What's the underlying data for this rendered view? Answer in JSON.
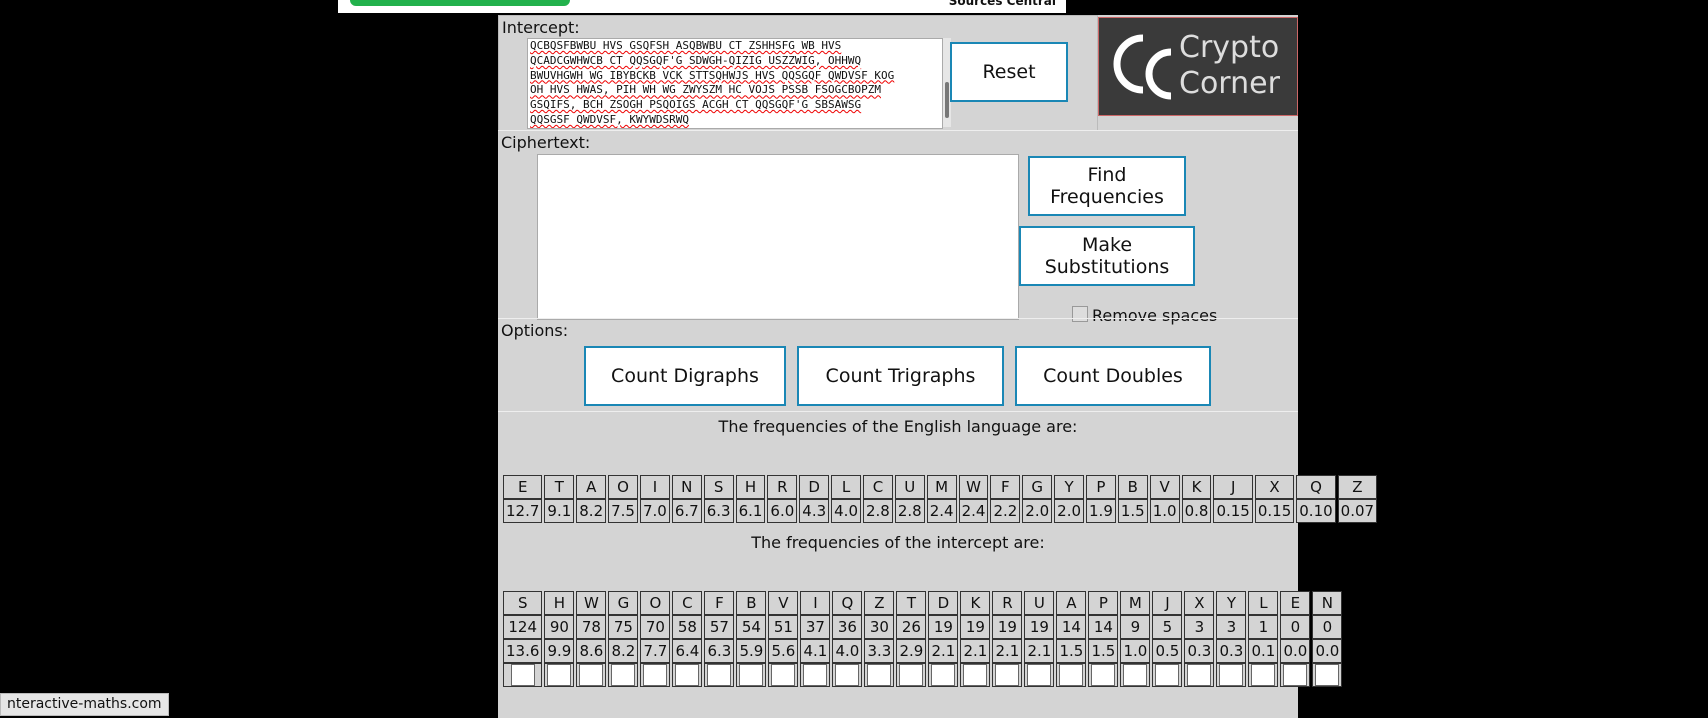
{
  "top": {
    "nav_text": "Sources Central"
  },
  "intercept": {
    "legend": "Intercept:",
    "lines": [
      "QCBQSFBWBU HVS GSQFSH ASQBWBU CT ZSHHSFG WB HVS",
      "QCADCGWHWCB CT QQSGQF'G SDWGH-QIZIG USZZWIG, OHHWQ",
      "BWUVHGWH WG IBYBCKB VCK STTSQHWJS HVS QQSGQF QWDVSF KOG",
      "OH HVS HWAS, PIH WH WG ZWYSZM HC VOJS PSSB FSOGCBOPZM",
      "GSQIFS, BCH ZSOGH PSQOIGS ACGH CT QQSGQF'G SBSAWSG",
      "QQSGSF QWDVSF, KWYWDSRWQ"
    ]
  },
  "buttons": {
    "reset": "Reset",
    "find_frequencies": "Find Frequencies",
    "make_substitutions": "Make Substitutions",
    "count_digraphs": "Count Digraphs",
    "count_trigraphs": "Count Trigraphs",
    "count_doubles": "Count Doubles"
  },
  "logo": {
    "line1": "Crypto",
    "line2": "Corner"
  },
  "ciphertext": {
    "legend": "Ciphertext:",
    "value": ""
  },
  "remove_spaces": {
    "label": "Remove spaces",
    "checked": false
  },
  "options": {
    "legend": "Options:"
  },
  "english": {
    "title": "The frequencies of the English language are:",
    "letters": [
      "E",
      "T",
      "A",
      "O",
      "I",
      "N",
      "S",
      "H",
      "R",
      "D",
      "L",
      "C",
      "U",
      "M",
      "W",
      "F",
      "G",
      "Y",
      "P",
      "B",
      "V",
      "K",
      "J",
      "X",
      "Q",
      "Z"
    ],
    "values": [
      "12.7",
      "9.1",
      "8.2",
      "7.5",
      "7.0",
      "6.7",
      "6.3",
      "6.1",
      "6.0",
      "4.3",
      "4.0",
      "2.8",
      "2.8",
      "2.4",
      "2.4",
      "2.2",
      "2.0",
      "2.0",
      "1.9",
      "1.5",
      "1.0",
      "0.8",
      "0.15",
      "0.15",
      "0.10",
      "0.07"
    ]
  },
  "intercept_freq": {
    "title": "The frequencies of the intercept are:",
    "letters": [
      "S",
      "H",
      "W",
      "G",
      "O",
      "C",
      "F",
      "B",
      "V",
      "I",
      "Q",
      "Z",
      "T",
      "D",
      "K",
      "R",
      "U",
      "A",
      "P",
      "M",
      "J",
      "X",
      "Y",
      "L",
      "E",
      "N"
    ],
    "counts": [
      "124",
      "90",
      "78",
      "75",
      "70",
      "58",
      "57",
      "54",
      "51",
      "37",
      "36",
      "30",
      "26",
      "19",
      "19",
      "19",
      "19",
      "14",
      "14",
      "9",
      "5",
      "3",
      "3",
      "1",
      "0",
      "0"
    ],
    "percents": [
      "13.6",
      "9.9",
      "8.6",
      "8.2",
      "7.7",
      "6.4",
      "6.3",
      "5.9",
      "5.6",
      "4.1",
      "4.0",
      "3.3",
      "2.9",
      "2.1",
      "2.1",
      "2.1",
      "2.1",
      "1.5",
      "1.5",
      "1.0",
      "0.5",
      "0.3",
      "0.3",
      "0.1",
      "0.0",
      "0.0"
    ]
  },
  "status_bar": {
    "text": "nteractive-maths.com"
  }
}
